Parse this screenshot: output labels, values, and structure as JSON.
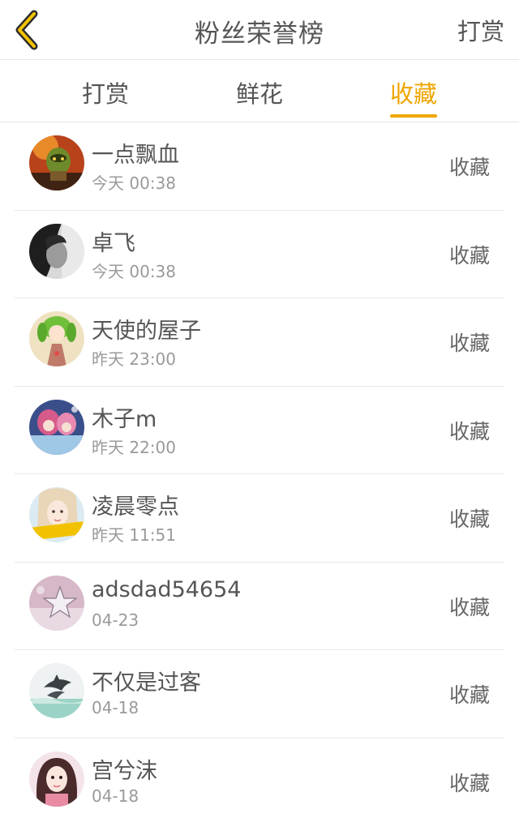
{
  "header": {
    "title": "粉丝荣誉榜",
    "action_label": "打赏",
    "accent_color": "#f0a500"
  },
  "tabs": [
    {
      "label": "打赏",
      "active": false
    },
    {
      "label": "鲜花",
      "active": false
    },
    {
      "label": "收藏",
      "active": true
    }
  ],
  "fans": [
    {
      "name": "一点飘血",
      "time": "今天 00:38",
      "type": "收藏",
      "avatar_icon": "orc-warrior-avatar"
    },
    {
      "name": "卓飞",
      "time": "今天 00:38",
      "type": "收藏",
      "avatar_icon": "dark-portrait-avatar"
    },
    {
      "name": "天使的屋子",
      "time": "昨天 23:00",
      "type": "收藏",
      "avatar_icon": "anime-green-hair-avatar"
    },
    {
      "name": "木子m",
      "time": "昨天 22:00",
      "type": "收藏",
      "avatar_icon": "colorful-anime-avatar"
    },
    {
      "name": "凌晨零点",
      "time": "昨天 11:51",
      "type": "收藏",
      "avatar_icon": "girl-photo-avatar"
    },
    {
      "name": "adsdad54654",
      "time": "04-23",
      "type": "收藏",
      "avatar_icon": "star-ornament-avatar"
    },
    {
      "name": "不仅是过客",
      "time": "04-18",
      "type": "收藏",
      "avatar_icon": "dolphin-avatar"
    },
    {
      "name": "宫兮沫",
      "time": "04-18",
      "type": "收藏",
      "avatar_icon": "girl-pink-avatar"
    }
  ]
}
